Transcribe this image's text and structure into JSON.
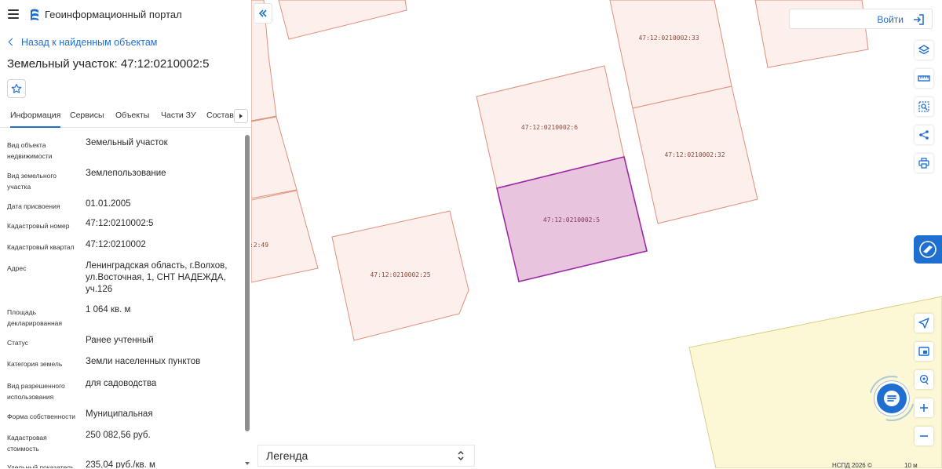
{
  "header": {
    "app_title": "Геоинформационный портал"
  },
  "nav": {
    "back_label": "Назад к найденным объектам"
  },
  "object": {
    "title": "Земельный участок: 47:12:0210002:5"
  },
  "tabs": [
    "Информация",
    "Сервисы",
    "Объекты",
    "Части ЗУ",
    "Состав"
  ],
  "properties": [
    {
      "label": "Вид объекта недвижимости",
      "value": "Земельный участок"
    },
    {
      "label": "Вид земельного участка",
      "value": "Землепользование"
    },
    {
      "label": "Дата присвоения",
      "value": "01.01.2005"
    },
    {
      "label": "Кадастровый номер",
      "value": "47:12:0210002:5"
    },
    {
      "label": "Кадастровый квартал",
      "value": "47:12:0210002"
    },
    {
      "label": "Адрес",
      "value": "Ленинградская область, г.Волхов, ул.Восточная, 1, СНТ НАДЕЖДА, уч.126"
    },
    {
      "label": "Площадь декларированная",
      "value": "1 064 кв. м"
    },
    {
      "label": "Статус",
      "value": "Ранее учтенный"
    },
    {
      "label": "Категория земель",
      "value": "Земли населенных пунктов"
    },
    {
      "label": "Вид разрешенного использования",
      "value": "для садоводства"
    },
    {
      "label": "Форма собственности",
      "value": "Муниципальная"
    },
    {
      "label": "Кадастровая стоимость",
      "value": "250 082,56 руб."
    },
    {
      "label": "Удельный показатель",
      "value": "235,04 руб./кв. м"
    }
  ],
  "map": {
    "login_label": "Войти",
    "legend_label": "Легенда",
    "copyright": "НСПД 2026 ©",
    "scale_label": "10 м",
    "parcel_labels": {
      "p33": "47:12:0210002:33",
      "p6": "47:12:0210002:6",
      "p32": "47:12:0210002:32",
      "p5": "47:12:0210002:5",
      "p25": "47:12:0210002:25",
      "p49": ":2:49"
    },
    "colors": {
      "parcel_fill": "#fdf0ec",
      "parcel_stroke": "#e0907a",
      "selected_fill": "#e9c4df",
      "selected_stroke": "#9c2aa5",
      "zone_fill": "#fcf8d6",
      "accent": "#1f6fd1"
    },
    "tools": [
      "layers-icon",
      "ruler-icon",
      "area-search-icon",
      "share-icon",
      "print-icon",
      "navigate-icon",
      "minimap-icon",
      "locate-icon",
      "zoom-in-icon",
      "zoom-out-icon"
    ]
  }
}
